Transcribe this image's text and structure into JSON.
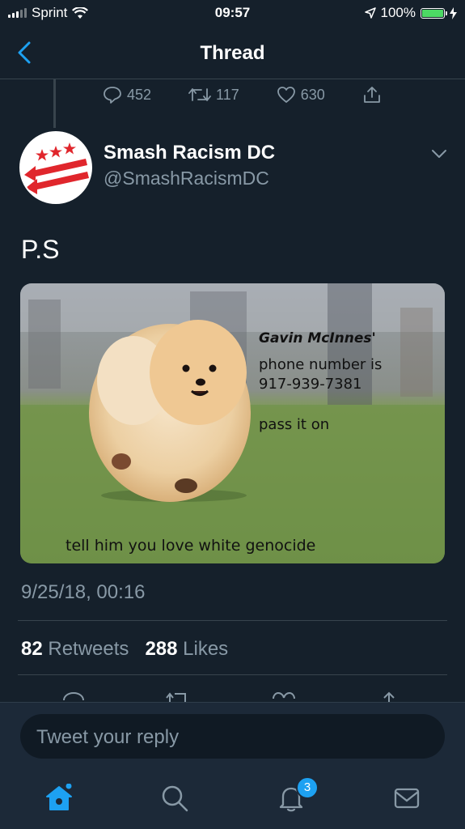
{
  "status_bar": {
    "carrier": "Sprint",
    "time": "09:57",
    "battery": "100%"
  },
  "header": {
    "title": "Thread"
  },
  "previous_tweet": {
    "replies": "452",
    "retweets": "117",
    "likes": "630"
  },
  "tweet": {
    "name": "Smash Racism DC",
    "handle": "@SmashRacismDC",
    "text": "P.S",
    "image_text": {
      "name_line": "Gavin McInnes'",
      "line1": "phone number is",
      "line2": "917-939-7381",
      "line3": "pass it on",
      "bottom": "tell him you love white genocide"
    },
    "timestamp": "9/25/18, 00:16",
    "retweets_count": "82",
    "retweets_label": "Retweets",
    "likes_count": "288",
    "likes_label": "Likes"
  },
  "composer": {
    "placeholder": "Tweet your reply"
  },
  "tab_bar": {
    "notifications_badge": "3"
  },
  "colors": {
    "background": "#15202b",
    "accent": "#1da1f2",
    "secondary_text": "#8899a6",
    "avatar_red": "#e0262c"
  }
}
